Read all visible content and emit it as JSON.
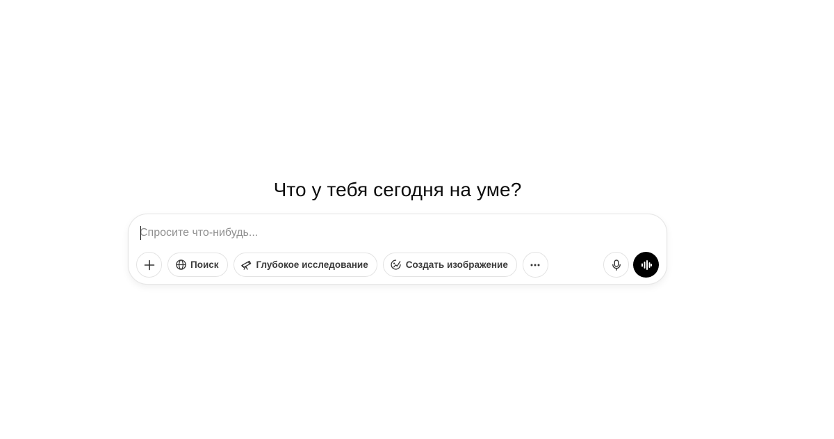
{
  "main": {
    "headline": "Что у тебя сегодня на уме?"
  },
  "composer": {
    "placeholder": "Спросите что-нибудь...",
    "value": "",
    "tools": {
      "attach_icon": "plus-icon",
      "search_label": "Поиск",
      "search_icon": "globe-icon",
      "deep_research_label": "Глубокое исследование",
      "deep_research_icon": "telescope-icon",
      "create_image_label": "Создать изображение",
      "create_image_icon": "image-brush-icon",
      "more_icon": "ellipsis-icon"
    },
    "dictate_icon": "microphone-icon",
    "voice_mode_icon": "waveform-icon"
  },
  "colors": {
    "background": "#ffffff",
    "text": "#0d0d0d",
    "placeholder": "#8f8f8f",
    "border": "#e3e3e3",
    "voice_button": "#000000"
  }
}
